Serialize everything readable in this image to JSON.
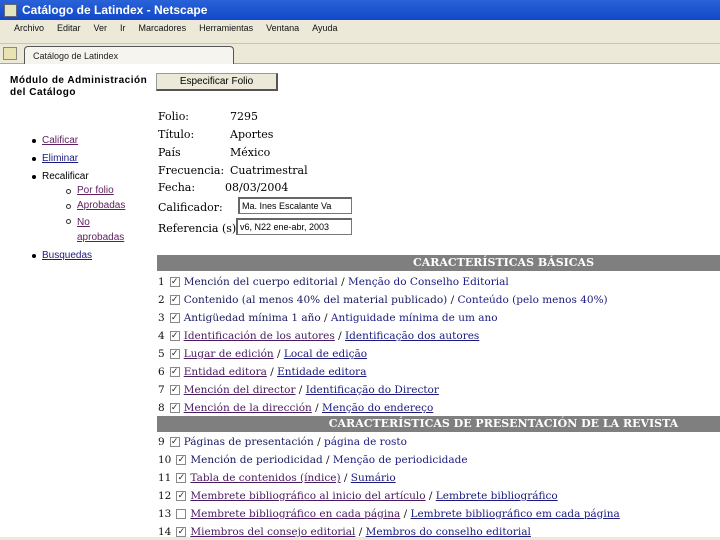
{
  "window": {
    "title": "Catálogo de Latindex - Netscape"
  },
  "menu": [
    "Archivo",
    "Editar",
    "Ver",
    "Ir",
    "Marcadores",
    "Herramientas",
    "Ventana",
    "Ayuda"
  ],
  "tab": {
    "label": "Catálogo de Latindex"
  },
  "sidebar": {
    "heading": "Módulo de Administración del Catálogo",
    "items": {
      "calificar": "Calificar",
      "eliminar": "Eliminar",
      "recalificar": "Recalificar",
      "por_folio": "Por folio",
      "aprobadas": "Aprobadas",
      "no_aprobadas": "No aprobadas",
      "busquedas": "Busquedas"
    }
  },
  "button": {
    "especificar": "Especificar Folio"
  },
  "info": {
    "folio_label": "Folio:",
    "folio": "7295",
    "titulo_label": "Título:",
    "titulo": "Aportes",
    "pais_label": "País",
    "pais": "México",
    "frecuencia_label": "Frecuencia:",
    "frecuencia": "Cuatrimestral",
    "fecha_label": "Fecha:",
    "fecha": "08/03/2004",
    "calificador_label": "Calificador:",
    "calificador": "Ma. Ines Escalante Va",
    "referencia_label": "Referencia (s)",
    "referencia": "v6, N22 ene-abr, 2003"
  },
  "sections": [
    {
      "title": "CARACTERÍSTICAS BÁSICAS",
      "items": [
        {
          "n": "1",
          "checked": true,
          "link": false,
          "es": "Mención del cuerpo editorial",
          "pt": "Menção do Conselho Editorial"
        },
        {
          "n": "2",
          "checked": true,
          "link": false,
          "es": "Contenido (al menos 40% del material publicado)",
          "pt": "Conteúdo (pelo menos 40%)"
        },
        {
          "n": "3",
          "checked": true,
          "link": false,
          "es": "Antigüedad mínima 1 año",
          "pt": "Antiguidade mínima de um ano"
        },
        {
          "n": "4",
          "checked": true,
          "link": true,
          "es": "Identificación de los autores",
          "pt": "Identificação dos autores"
        },
        {
          "n": "5",
          "checked": true,
          "link": true,
          "es": "Lugar de edición",
          "pt": "Local de edição"
        },
        {
          "n": "6",
          "checked": true,
          "link": true,
          "es": "Entidad editora",
          "pt": "Entidade editora"
        },
        {
          "n": "7",
          "checked": true,
          "link": true,
          "es": "Mención del director",
          "pt": "Identificação do Director"
        },
        {
          "n": "8",
          "checked": true,
          "link": true,
          "es": "Mención de la dirección",
          "pt": "Menção do endereço"
        }
      ]
    },
    {
      "title": "CARACTERÍSTICAS DE PRESENTACIÓN DE LA REVISTA",
      "items": [
        {
          "n": "9",
          "checked": true,
          "link": false,
          "es": "Páginas de presentación",
          "pt": "página de rosto"
        },
        {
          "n": "10",
          "checked": true,
          "link": false,
          "es": "Mención de periodicidad",
          "pt": "Menção de periodicidade"
        },
        {
          "n": "11",
          "checked": true,
          "link": true,
          "es": "Tabla de contenidos (índice)",
          "pt": "Sumário"
        },
        {
          "n": "12",
          "checked": true,
          "link": true,
          "es": "Membrete bibliográfico al inicio del artículo",
          "pt": "Lembrete bibliográfico"
        },
        {
          "n": "13",
          "checked": false,
          "link": true,
          "es": "Membrete bibliográfico en cada página",
          "pt": "Lembrete bibliográfico em cada página"
        },
        {
          "n": "14",
          "checked": true,
          "link": true,
          "es": "Miembros del consejo editorial",
          "pt": "Membros do conselho editorial"
        }
      ]
    }
  ]
}
